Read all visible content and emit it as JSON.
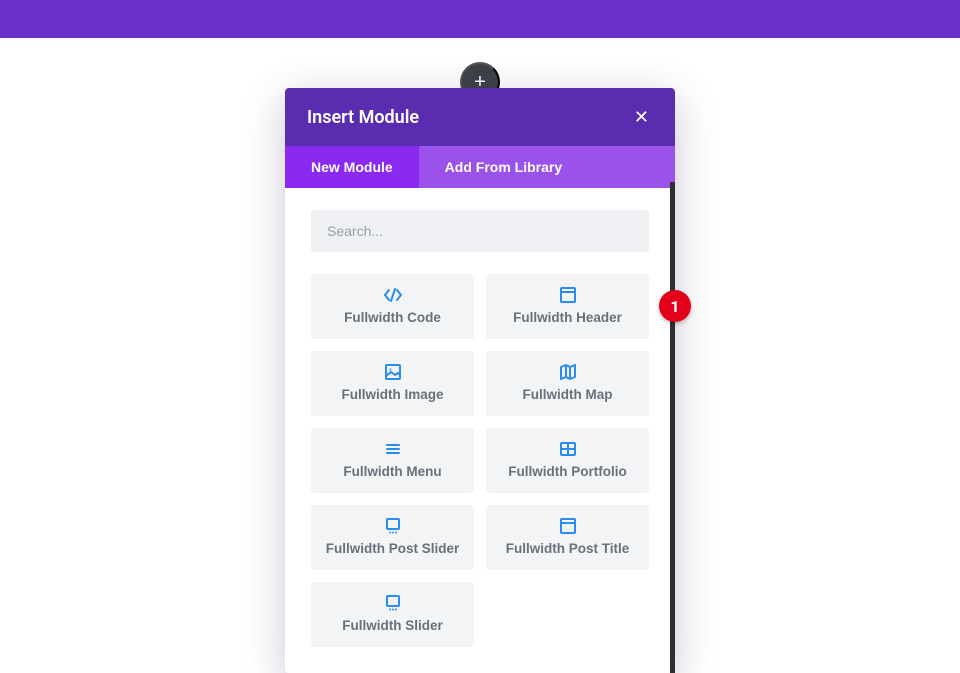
{
  "topbar": {},
  "add_button": {
    "glyph": "+"
  },
  "modal": {
    "title": "Insert Module",
    "close_glyph": "✕",
    "tabs": {
      "new": "New Module",
      "library": "Add From Library"
    },
    "search": {
      "placeholder": "Search..."
    },
    "modules": [
      {
        "id": "fullwidth-code",
        "label": "Fullwidth Code",
        "icon": "code"
      },
      {
        "id": "fullwidth-header",
        "label": "Fullwidth Header",
        "icon": "header"
      },
      {
        "id": "fullwidth-image",
        "label": "Fullwidth Image",
        "icon": "image"
      },
      {
        "id": "fullwidth-map",
        "label": "Fullwidth Map",
        "icon": "map"
      },
      {
        "id": "fullwidth-menu",
        "label": "Fullwidth Menu",
        "icon": "menu"
      },
      {
        "id": "fullwidth-portfolio",
        "label": "Fullwidth Portfolio",
        "icon": "portfolio"
      },
      {
        "id": "fullwidth-post-slider",
        "label": "Fullwidth Post Slider",
        "icon": "post-slider"
      },
      {
        "id": "fullwidth-post-title",
        "label": "Fullwidth Post Title",
        "icon": "post-title"
      },
      {
        "id": "fullwidth-slider",
        "label": "Fullwidth Slider",
        "icon": "slider"
      }
    ]
  },
  "annotation": {
    "badge": "1"
  },
  "colors": {
    "brand_dark": "#5a2cb0",
    "brand_light": "#9b52eb",
    "brand_active": "#8a2af0",
    "icon_blue": "#2a8cf0",
    "badge_red": "#e3001b"
  }
}
